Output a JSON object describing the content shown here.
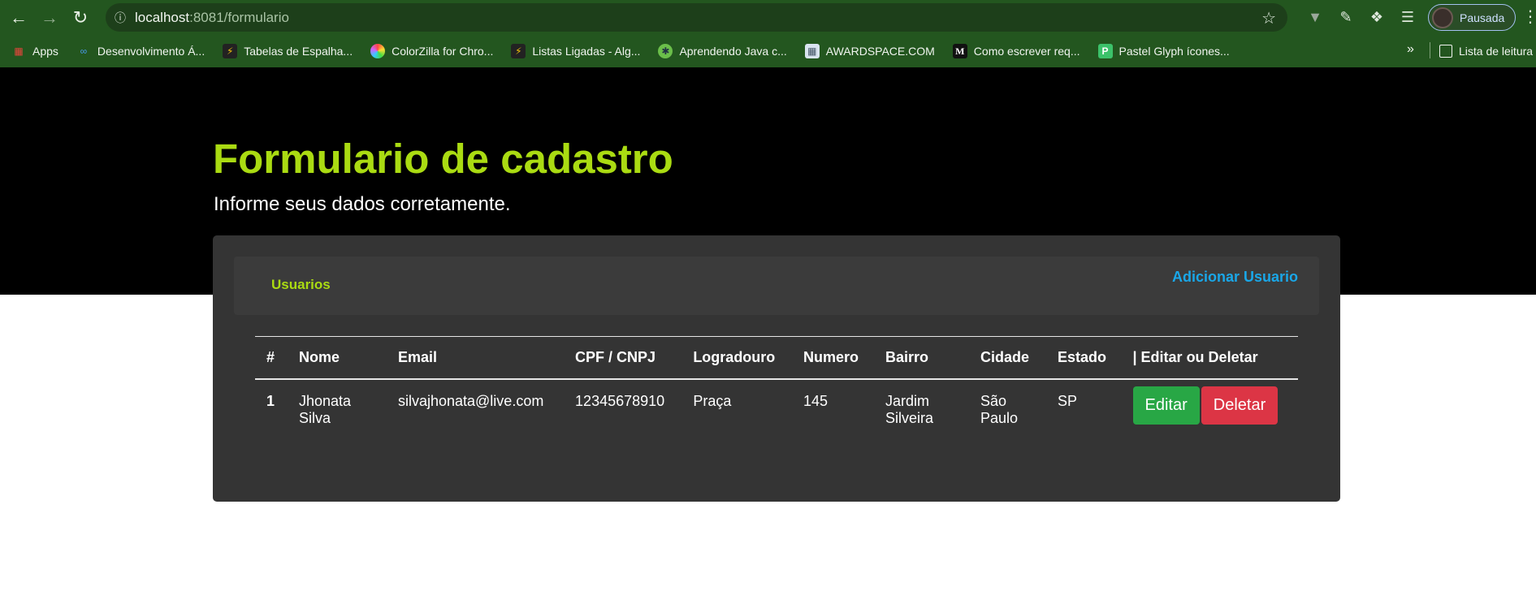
{
  "browser": {
    "url_host": "localhost",
    "url_path": ":8081/formulario",
    "profile_name": "Pausada",
    "bookmarks": [
      {
        "label": "Apps",
        "icon": "apps-grid-icon",
        "color": "#e8453c"
      },
      {
        "label": "Desenvolvimento Á...",
        "icon": "infinity-icon",
        "color": "#4a9cf0"
      },
      {
        "label": "Tabelas de Espalha...",
        "icon": "bolt-icon",
        "color": "#f4c20d"
      },
      {
        "label": "ColorZilla for Chro...",
        "icon": "color-wheel-icon",
        "color": "#c561f5"
      },
      {
        "label": "Listas Ligadas - Alg...",
        "icon": "bolt-icon",
        "color": "#f4c20d"
      },
      {
        "label": "Aprendendo Java c...",
        "icon": "gear-icon",
        "color": "#6bbf4a"
      },
      {
        "label": "AWARDSPACE.COM",
        "icon": "grid-icon",
        "color": "#d9e4f0"
      },
      {
        "label": "Como escrever req...",
        "icon": "medium-icon",
        "color": "#111111"
      },
      {
        "label": "Pastel Glyph ícones...",
        "icon": "pastel-icon",
        "color": "#3cc26a"
      }
    ],
    "more_bookmarks": "»",
    "reading_list": "Lista de leitura"
  },
  "page": {
    "title": "Formulario de cadastro",
    "subtitle": "Informe seus dados corretamente.",
    "tab_label": "Usuarios",
    "add_user_label": "Adicionar Usuario"
  },
  "table": {
    "headers": [
      "#",
      "Nome",
      "Email",
      "CPF / CNPJ",
      "Logradouro",
      "Numero",
      "Bairro",
      "Cidade",
      "Estado",
      "| Editar ou Deletar"
    ],
    "rows": [
      {
        "id": "1",
        "nome": "Jhonata Silva",
        "email": "silvajhonata@live.com",
        "cpf": "12345678910",
        "logradouro": "Praça",
        "numero": "145",
        "bairro": "Jardim Silveira",
        "cidade": "São Paulo",
        "estado": "SP",
        "edit_label": "Editar",
        "delete_label": "Deletar"
      }
    ]
  },
  "colors": {
    "chrome": "#23561f",
    "title_green": "#aadb12",
    "link_blue": "#1aa7e8",
    "edit_green": "#28a745",
    "delete_red": "#dc3545"
  }
}
